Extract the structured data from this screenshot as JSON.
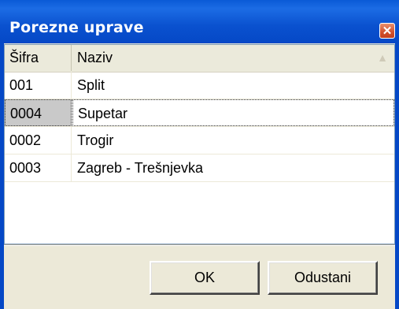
{
  "window": {
    "title": "Porezne uprave"
  },
  "list": {
    "columns": [
      "Šifra",
      "Naziv"
    ],
    "rows": [
      {
        "code": "001",
        "name": "Split"
      },
      {
        "code": "0004",
        "name": "Supetar"
      },
      {
        "code": "0002",
        "name": "Trogir"
      },
      {
        "code": "0003",
        "name": "Zagreb - Trešnjevka"
      }
    ],
    "selected_index": 1
  },
  "buttons": {
    "ok": "OK",
    "cancel": "Odustani"
  },
  "icons": {
    "close": "close-icon",
    "sort": "sort-ascending-icon"
  },
  "colors": {
    "title_bar": "#0548c6",
    "close": "#d1502e",
    "selection": "#c9c9c9"
  }
}
